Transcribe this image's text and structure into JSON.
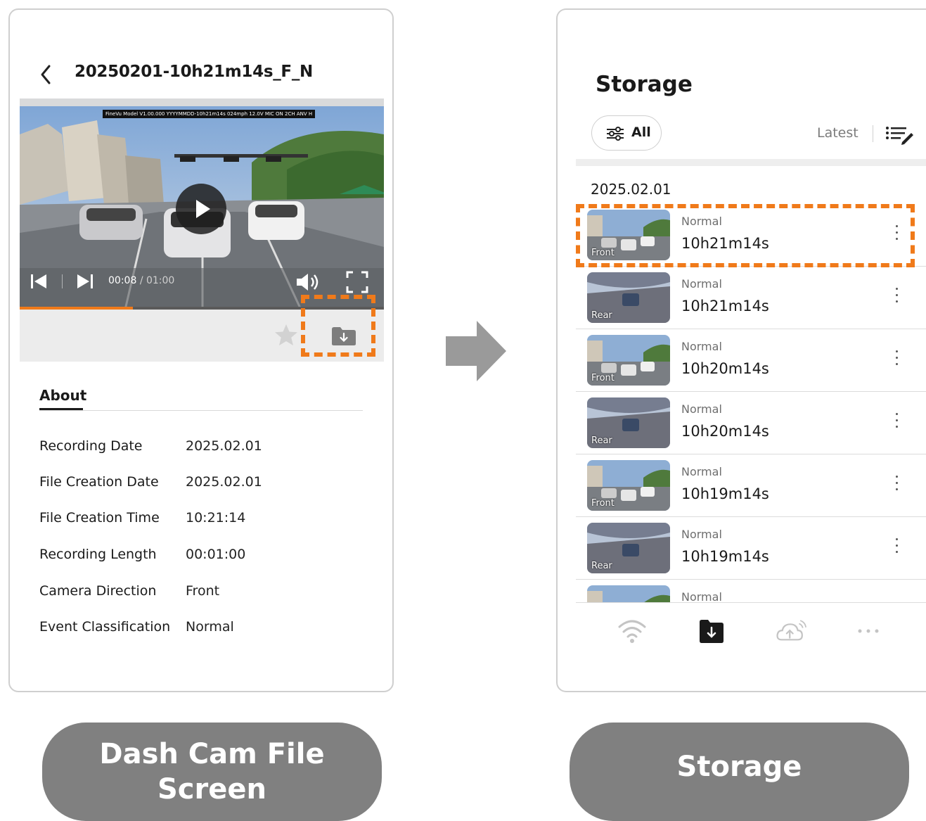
{
  "file_screen": {
    "title": "20250201-10h21m14s_F_N",
    "video_overlay": "FineVu Model V1.00.000 YYYYMMDD-10h21m14s 024mph 12.0V MIC ON 2CH ANV H",
    "time_current": "00:08",
    "time_total": "/ 01:00",
    "progress": 0.31,
    "about_tab": "About",
    "info": [
      {
        "label": "Recording Date",
        "value": "2025.02.01"
      },
      {
        "label": "File Creation Date",
        "value": "2025.02.01"
      },
      {
        "label": "File Creation Time",
        "value": "10:21:14"
      },
      {
        "label": "Recording Length",
        "value": "00:01:00"
      },
      {
        "label": "Camera Direction",
        "value": "Front"
      },
      {
        "label": "Event Classification",
        "value": "Normal"
      }
    ]
  },
  "storage_screen": {
    "title": "Storage",
    "filter_label": "All",
    "sort_label": "Latest",
    "date_header": "2025.02.01",
    "items": [
      {
        "camera": "Front",
        "type": "Normal",
        "time": "10h21m14s"
      },
      {
        "camera": "Rear",
        "type": "Normal",
        "time": "10h21m14s"
      },
      {
        "camera": "Front",
        "type": "Normal",
        "time": "10h20m14s"
      },
      {
        "camera": "Rear",
        "type": "Normal",
        "time": "10h20m14s"
      },
      {
        "camera": "Front",
        "type": "Normal",
        "time": "10h19m14s"
      },
      {
        "camera": "Rear",
        "type": "Normal",
        "time": "10h19m14s"
      },
      {
        "camera": "",
        "type": "Normal",
        "time": ""
      }
    ],
    "nav": [
      {
        "icon": "wifi-icon"
      },
      {
        "icon": "download-folder-icon"
      },
      {
        "icon": "cloud-upload-icon"
      },
      {
        "icon": "more-horizontal-icon"
      }
    ]
  },
  "captions": {
    "left": "Dash Cam File Screen",
    "right": "Storage"
  },
  "colors": {
    "highlight": "#f07a1a",
    "caption_bg": "#808080"
  }
}
